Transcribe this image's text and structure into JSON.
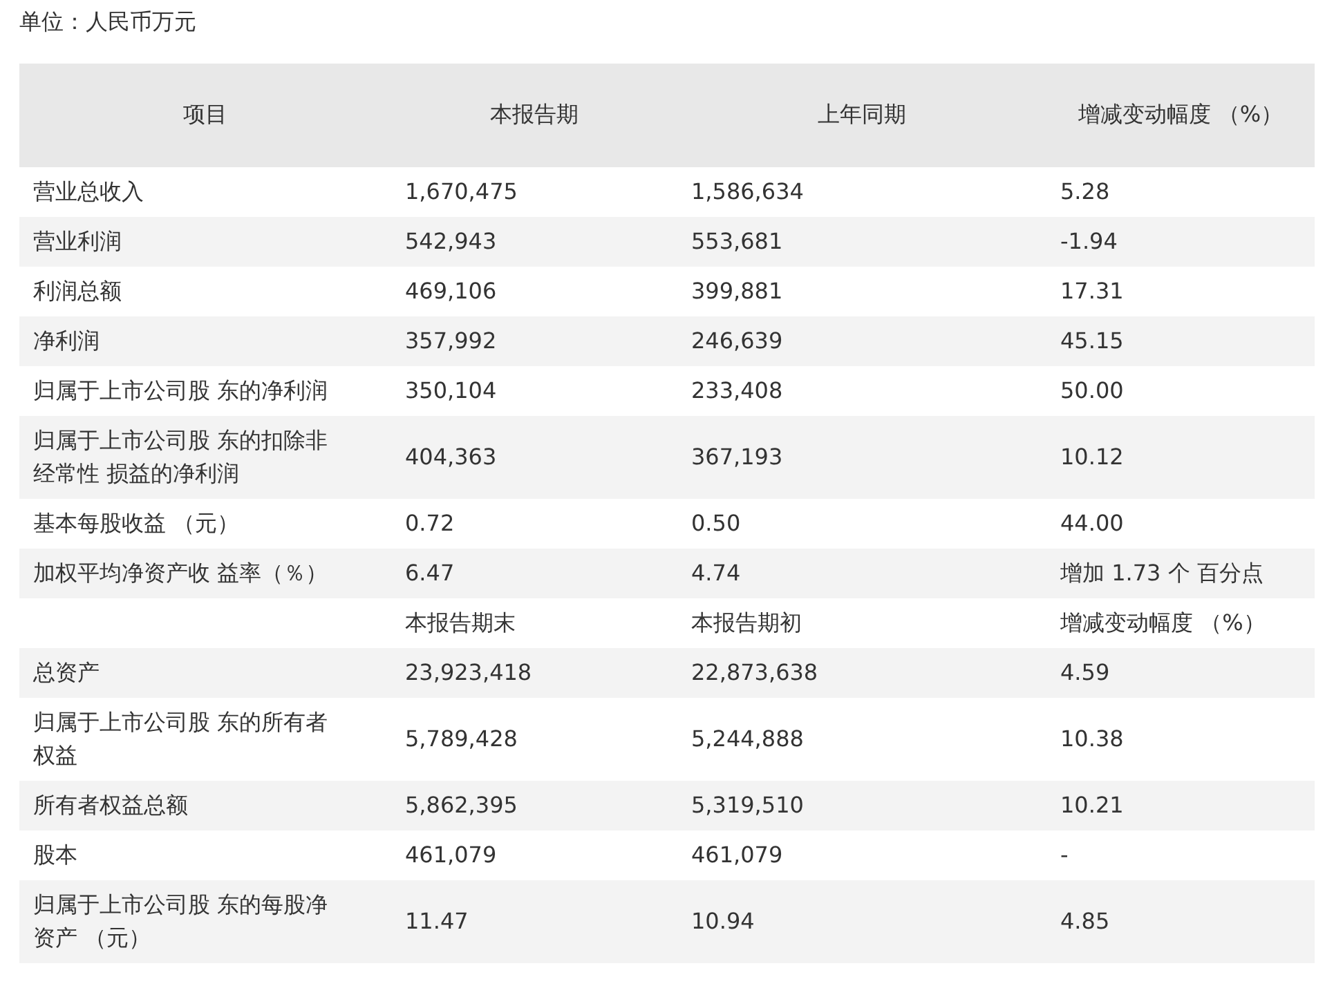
{
  "unit_label": "单位：人民币万元",
  "table": {
    "columns": [
      "项目",
      "本报告期",
      "上年同期",
      "增减变动幅度 （%）"
    ],
    "rows": [
      [
        "营业总收入",
        "1,670,475",
        "1,586,634",
        "5.28"
      ],
      [
        "营业利润",
        "542,943",
        "553,681",
        "-1.94"
      ],
      [
        "利润总额",
        "469,106",
        "399,881",
        "17.31"
      ],
      [
        "净利润",
        "357,992",
        "246,639",
        "45.15"
      ],
      [
        "归属于上市公司股 东的净利润",
        "350,104",
        "233,408",
        "50.00"
      ],
      [
        "归属于上市公司股 东的扣除非经常性 损益的净利润",
        "404,363",
        "367,193",
        "10.12"
      ],
      [
        "基本每股收益 （元）",
        "0.72",
        "0.50",
        "44.00"
      ],
      [
        "加权平均净资产收 益率（％）",
        "6.47",
        "4.74",
        "增加 1.73 个 百分点"
      ],
      [
        "",
        "本报告期末",
        "本报告期初",
        "增减变动幅度 （%）"
      ],
      [
        "总资产",
        "23,923,418",
        "22,873,638",
        "4.59"
      ],
      [
        "归属于上市公司股 东的所有者权益",
        "5,789,428",
        "5,244,888",
        "10.38"
      ],
      [
        "所有者权益总额",
        "5,862,395",
        "5,319,510",
        "10.21"
      ],
      [
        "股本",
        "461,079",
        "461,079",
        "-"
      ],
      [
        "归属于上市公司股 东的每股净资产 （元）",
        "11.47",
        "10.94",
        "4.85"
      ]
    ]
  }
}
